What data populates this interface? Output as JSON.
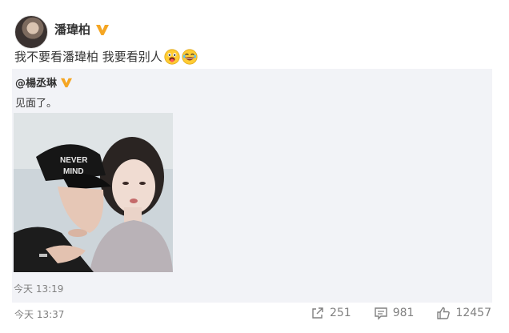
{
  "post": {
    "author": "潘瑋柏",
    "text": "我不要看潘瑋柏 我要看别人",
    "emojis": [
      "tongue-out-face",
      "laughing-face"
    ],
    "time": "今天 13:37"
  },
  "repost": {
    "author": "@楊丞琳",
    "text": "见面了。",
    "time": "今天 13:19"
  },
  "actions": {
    "share_count": "251",
    "comment_count": "981",
    "like_count": "12457"
  },
  "colors": {
    "verified_badge": "#f5a623",
    "repost_background": "#f2f3f7",
    "meta_text": "#808080"
  }
}
